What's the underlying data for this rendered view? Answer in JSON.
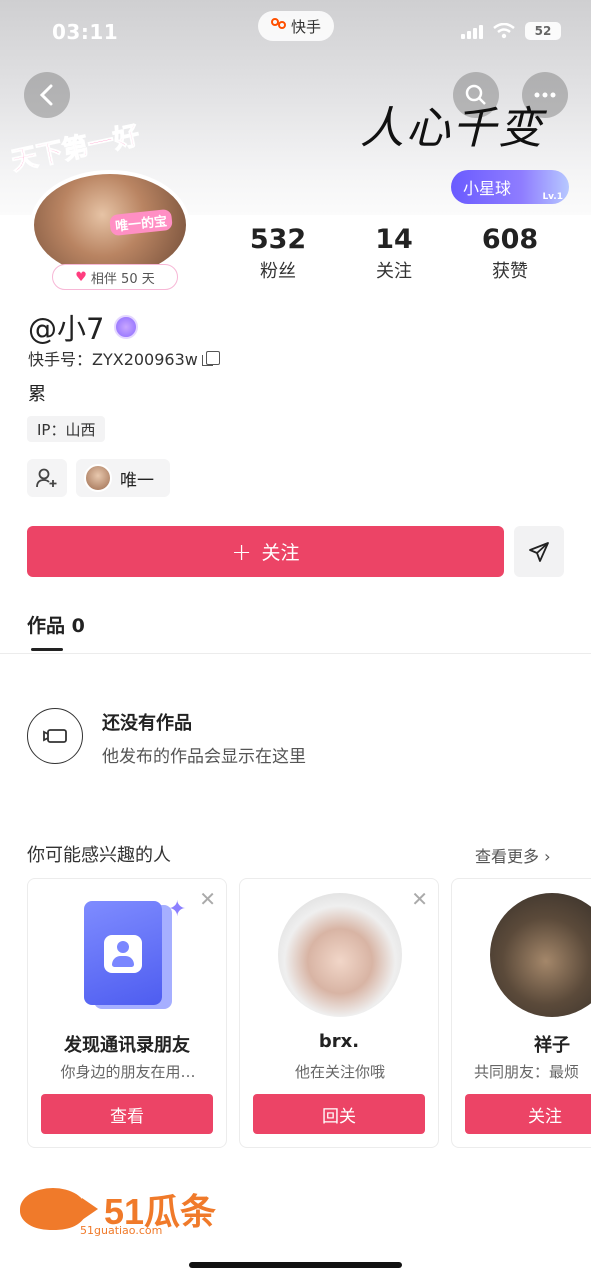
{
  "status_bar": {
    "time": "03:11",
    "app_name": "快手",
    "battery": "52"
  },
  "header": {
    "signature_text": "人心千变",
    "planet_label": "小星球",
    "planet_level": "Lv.1",
    "avatar_frame_text": "天下第一好",
    "avatar_frame_tag": "唯一的宝",
    "companion_days": "相伴 50 天"
  },
  "stats": [
    {
      "value": "532",
      "label": "粉丝"
    },
    {
      "value": "14",
      "label": "关注"
    },
    {
      "value": "608",
      "label": "获赞"
    }
  ],
  "profile": {
    "username": "@小7",
    "kuaishou_id": "快手号：ZYX200963w",
    "bio": "累",
    "ip": "IP：山西",
    "friend_chip_label": "唯一"
  },
  "actions": {
    "follow_label": "关注"
  },
  "tabs": {
    "works": "作品 0"
  },
  "empty_state": {
    "title": "还没有作品",
    "subtitle": "他发布的作品会显示在这里"
  },
  "recommend": {
    "title": "你可能感兴趣的人",
    "more": "查看更多",
    "cards": [
      {
        "name": "发现通讯录朋友",
        "desc": "你身边的朋友在用…",
        "cta": "查看"
      },
      {
        "name": "brx.",
        "desc": "他在关注你哦",
        "cta": "回关"
      },
      {
        "name": "祥子",
        "desc": "共同朋友：最烦",
        "cta": "关注"
      }
    ]
  },
  "watermark": {
    "brand": "51瓜条",
    "url": "51guatiao.com"
  },
  "colors": {
    "accent": "#ec4466",
    "planet": "#6a5bff",
    "watermark": "#f07a2a"
  }
}
